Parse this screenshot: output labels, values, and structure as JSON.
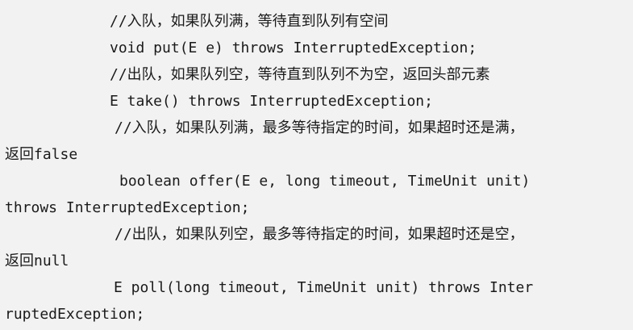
{
  "code": {
    "lines": [
      "//入队，如果队列满，等待直到队列有空间",
      "void put(E e) throws InterruptedException;",
      "//出队，如果队列空，等待直到队列不为空，返回头部元素",
      "E take() throws InterruptedException;",
      "//入队，如果队列满，最多等待指定的时间，如果超时还是满，",
      "返回false",
      "boolean offer(E e, long timeout, TimeUnit unit)",
      "throws InterruptedException;",
      "//出队，如果队列空，最多等待指定的时间，如果超时还是空，",
      "返回null",
      "E poll(long timeout, TimeUnit unit) throws Inter",
      "ruptedException;"
    ]
  }
}
